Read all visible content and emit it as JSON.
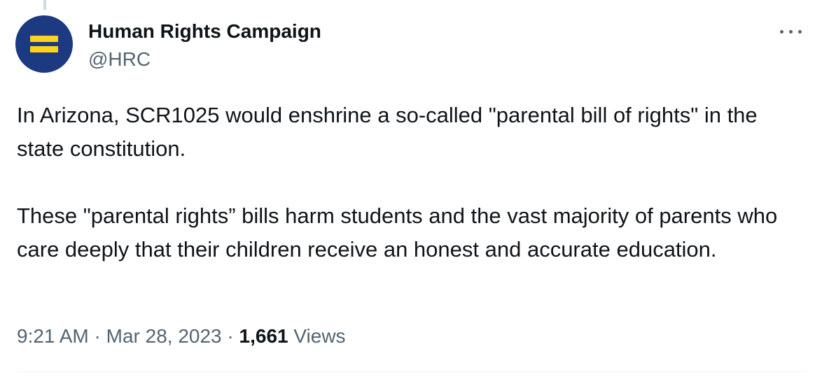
{
  "tweet": {
    "author": {
      "display_name": "Human Rights Campaign",
      "handle": "@HRC",
      "avatar_icon": "hrc-equality-logo-icon",
      "avatar_colors": {
        "background": "#1b3a82",
        "bars": "#fcd21c"
      }
    },
    "more_icon": "more-horizontal-icon",
    "text": {
      "paragraph_1": "In Arizona, SCR1025 would enshrine a so-called \"parental bill of rights\" in the state constitution.",
      "paragraph_2": "These \"parental rights” bills harm students and the vast majority of parents who care deeply that their children receive an honest and accurate education."
    },
    "meta": {
      "time": "9:21 AM",
      "separator": " · ",
      "date": "Mar 28, 2023",
      "views_count": "1,661",
      "views_label": "Views"
    }
  },
  "colors": {
    "primary_text": "#0f1419",
    "secondary_text": "#536471",
    "divider": "#eff3f4"
  }
}
